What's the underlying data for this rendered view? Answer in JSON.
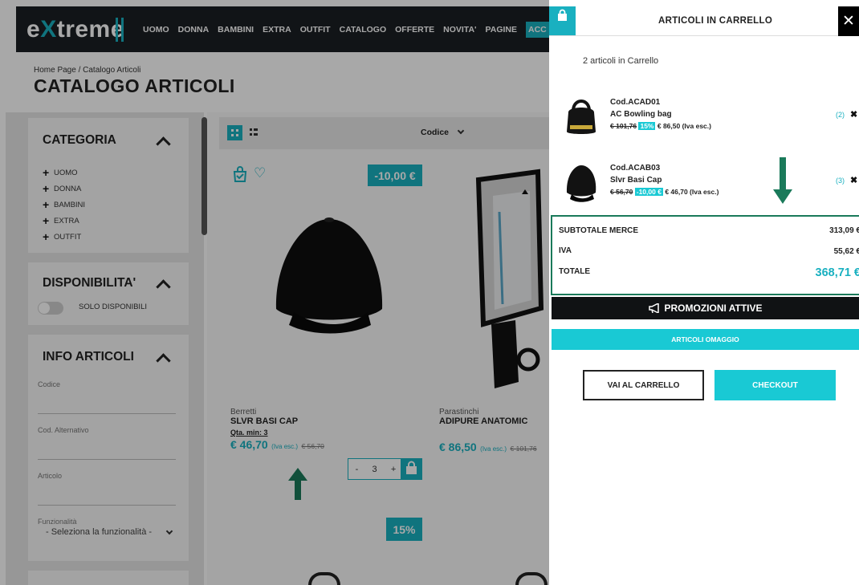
{
  "header": {
    "logo_prefix": "e",
    "logo_x": "X",
    "logo_rest": "treme",
    "nav": [
      "UOMO",
      "DONNA",
      "BAMBINI",
      "EXTRA",
      "OUTFIT",
      "CATALOGO",
      "OFFERTE",
      "NOVITA'",
      "PAGINE"
    ],
    "nav_accent": "ACC"
  },
  "page": {
    "breadcrumb": "Home Page /  Catalogo Articoli",
    "title": "CATALOGO ARTICOLI"
  },
  "sidebar": {
    "categoria_title": "CATEGORIA",
    "categories": [
      "UOMO",
      "DONNA",
      "BAMBINI",
      "EXTRA",
      "OUTFIT"
    ],
    "disponibilita_title": "DISPONIBILITA'",
    "solo_disponibili": "SOLO DISPONIBILI",
    "info_title": "INFO ARTICOLI",
    "codice_label": "Codice",
    "cod_alt_label": "Cod. Alternativo",
    "articolo_label": "Articolo",
    "funzionalita_label": "Funzionalità",
    "funzionalita_value": "- Seleziona la funzionalità -"
  },
  "toolbar": {
    "sort_label": "Codice"
  },
  "products": [
    {
      "category": "Berretti",
      "name": "SLVR BASI CAP",
      "min_qty_label": "Qta. min: 3",
      "price": "€ 46,70",
      "iva": "(Iva esc.)",
      "old_price": "€ 56,70",
      "badge": "-10,00 €",
      "qty": "3"
    },
    {
      "category": "Parastinchi",
      "name": "ADIPURE ANATOMIC",
      "price": "€ 86,50",
      "iva": "(Iva esc.)",
      "old_price": "€ 101,76",
      "badge": "15%"
    }
  ],
  "qty_controls": {
    "minus": "-",
    "plus": "+"
  },
  "cart": {
    "title": "ARTICOLI IN CARRELLO",
    "close": "✕",
    "count_text": "2 articoli in Carrello",
    "items": [
      {
        "code": "Cod.ACAD01",
        "name": "AC Bowling bag",
        "old_price": "€ 101,76",
        "discount": "15%",
        "price": "€ 86,50 (Iva esc.)",
        "qty": "(2)",
        "remove": "✖"
      },
      {
        "code": "Cod.ACAB03",
        "name": "Slvr Basi Cap",
        "old_price": "€ 56,70",
        "discount": "-10,00 €",
        "price": "€ 46,70 (Iva esc.)",
        "qty": "(3)",
        "remove": "✖"
      }
    ],
    "subtotal_label": "SUBTOTALE MERCE",
    "subtotal_value": "313,09 €",
    "iva_label": "IVA",
    "iva_value": "55,62 €",
    "total_label": "TOTALE",
    "total_value": "368,71 €",
    "promo_button": "PROMOZIONI ATTIVE",
    "gift_button": "ARTICOLI OMAGGIO",
    "cart_button": "VAI AL CARRELLO",
    "checkout_button": "CHECKOUT"
  },
  "colors": {
    "accent": "#19b0c0",
    "dark": "#1b1f24",
    "annotation_arrow": "#1a7a5a"
  }
}
